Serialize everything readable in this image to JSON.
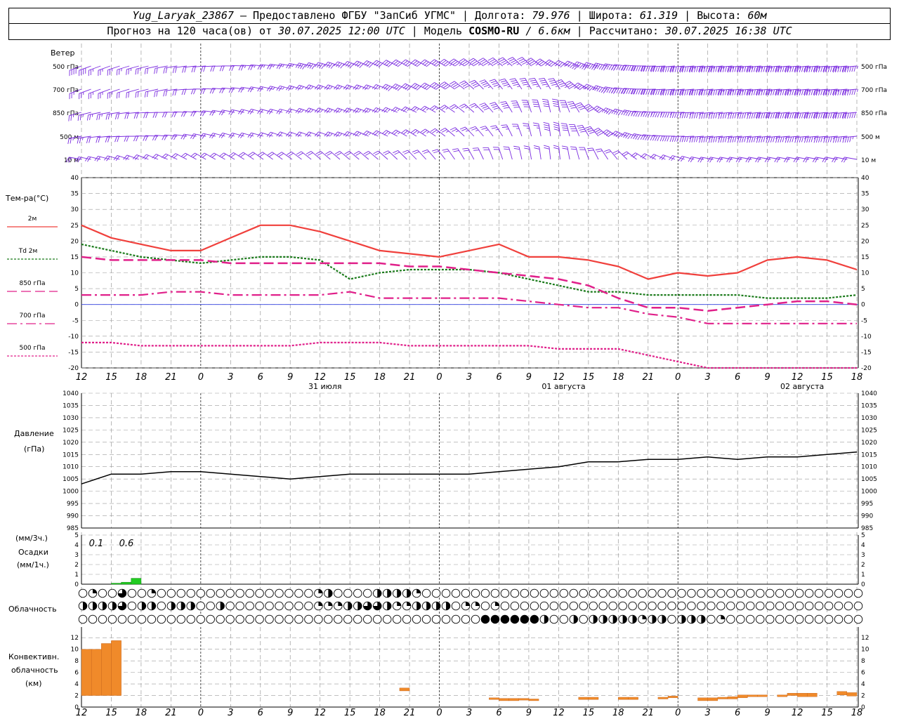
{
  "header": {
    "station": "Yug_Laryak_23867",
    "provided_by": "— Предоставлено ФГБУ \"ЗапСиб УГМС\"",
    "lon_label": "Долгота:",
    "lon_value": "79.976",
    "lat_label": "Широта:",
    "lat_value": "61.319",
    "alt_label": "Высота:",
    "alt_value": "60м",
    "forecast_label": "Прогноз на 120 часа(ов) от",
    "forecast_start": "30.07.2025 12:00 UTC",
    "model_label": "Модель",
    "model_name": "COSMO-RU",
    "model_res": "/ 6.6км",
    "computed_label": "Рассчитано:",
    "computed_time": "30.07.2025 16:38 UTC"
  },
  "panels": {
    "wind": {
      "title": "Ветер",
      "levels": [
        "500 гПа",
        "700 гПа",
        "850 гПа",
        "500 м",
        "10 м"
      ],
      "color": "#7b2ce0"
    },
    "temperature": {
      "title": "Тем-ра(°C)",
      "legend": [
        {
          "label": "2м",
          "color": "#f0403c"
        },
        {
          "label": "Td 2м",
          "color": "#1a7a1a"
        },
        {
          "label": "850 гПа",
          "color": "#e0208a"
        },
        {
          "label": "700 гПа",
          "color": "#e0208a"
        },
        {
          "label": "500 гПа",
          "color": "#e0208a"
        }
      ],
      "yticks": [
        "40",
        "35",
        "30",
        "25",
        "20",
        "15",
        "10",
        "5",
        "0",
        "-5",
        "-10",
        "-15",
        "-20"
      ]
    },
    "pressure": {
      "title": "Давление",
      "unit": "(гПа)",
      "yticks": [
        "1040",
        "1035",
        "1030",
        "1025",
        "1020",
        "1015",
        "1010",
        "1005",
        "1000",
        "995",
        "990",
        "985"
      ]
    },
    "precip": {
      "unit1": "(мм/3ч.)",
      "title": "Осадки",
      "unit2": "(мм/1ч.)",
      "yticks": [
        "5",
        "4",
        "3",
        "2",
        "1",
        "0"
      ],
      "annotations": [
        "0.1",
        "0.6"
      ],
      "color": "#22cc22"
    },
    "cloud": {
      "title": "Облачность"
    },
    "conv": {
      "title1": "Конвективн.",
      "title2": "облачность",
      "unit": "(км)",
      "yticks": [
        "12",
        "10",
        "8",
        "6",
        "4",
        "2",
        "0"
      ],
      "color": "#f08a2a"
    }
  },
  "time_axis": {
    "hour_labels": [
      "12",
      "15",
      "18",
      "21",
      "0",
      "3",
      "6",
      "9",
      "12",
      "15",
      "18",
      "21",
      "0",
      "3",
      "6",
      "9",
      "12",
      "15",
      "18",
      "21",
      "0",
      "3",
      "6",
      "9",
      "12",
      "15",
      "18"
    ],
    "date_labels": [
      "31 июля",
      "01 августа",
      "02 августа"
    ]
  },
  "chart_data": {
    "type": "line",
    "x_hours_from_start": [
      0,
      3,
      6,
      9,
      12,
      15,
      18,
      21,
      24,
      27,
      30,
      33,
      36,
      39,
      42,
      45,
      48,
      51,
      54,
      57,
      60,
      63,
      66,
      69,
      72,
      75,
      78
    ],
    "series": [
      {
        "name": "2м",
        "values": [
          25,
          21,
          19,
          17,
          17,
          21,
          25,
          25,
          23,
          20,
          17,
          16,
          15,
          17,
          19,
          15,
          15,
          14,
          12,
          8,
          10,
          9,
          10,
          14,
          15,
          14,
          11
        ]
      },
      {
        "name": "Td 2м",
        "values": [
          19,
          17,
          15,
          14,
          13,
          14,
          15,
          15,
          14,
          8,
          10,
          11,
          11,
          11,
          10,
          8,
          6,
          4,
          4,
          3,
          3,
          3,
          3,
          2,
          2,
          2,
          3
        ]
      },
      {
        "name": "850 гПа",
        "values": [
          15,
          14,
          14,
          14,
          14,
          13,
          13,
          13,
          13,
          13,
          13,
          12,
          12,
          11,
          10,
          9,
          8,
          6,
          2,
          -1,
          -1,
          -2,
          -1,
          0,
          1,
          1,
          0
        ]
      },
      {
        "name": "700 гПа",
        "values": [
          3,
          3,
          3,
          4,
          4,
          3,
          3,
          3,
          3,
          4,
          2,
          2,
          2,
          2,
          2,
          1,
          0,
          -1,
          -1,
          -3,
          -4,
          -6,
          -6,
          -6,
          -6,
          -6,
          -6
        ]
      },
      {
        "name": "500 гПа",
        "values": [
          -12,
          -12,
          -13,
          -13,
          -13,
          -13,
          -13,
          -13,
          -12,
          -12,
          -12,
          -13,
          -13,
          -13,
          -13,
          -13,
          -14,
          -14,
          -14,
          -16,
          -18,
          -20,
          -21,
          -21,
          -21,
          -21,
          -21
        ]
      },
      {
        "name": "Давление",
        "values": [
          1003,
          1007,
          1007,
          1008,
          1008,
          1007,
          1006,
          1005,
          1006,
          1007,
          1007,
          1007,
          1007,
          1007,
          1008,
          1009,
          1010,
          1012,
          1012,
          1013,
          1013,
          1014,
          1013,
          1014,
          1014,
          1015,
          1016
        ]
      }
    ],
    "precip_3h": [
      {
        "x": 3,
        "value": 0.1
      },
      {
        "x": 6,
        "value": 0.6
      }
    ],
    "precip_1h": [
      {
        "x": 4,
        "value": 0.1
      },
      {
        "x": 5,
        "value": 0.2
      },
      {
        "x": 6,
        "value": 0.6
      }
    ],
    "convective_cloud_km": [
      {
        "x": 1,
        "base": 2,
        "top": 10
      },
      {
        "x": 2,
        "base": 2,
        "top": 10
      },
      {
        "x": 3,
        "base": 2,
        "top": 11
      },
      {
        "x": 4,
        "base": 2,
        "top": 11.5
      },
      {
        "x": 33,
        "base": 2.8,
        "top": 3.3
      },
      {
        "x": 42,
        "base": 1.3,
        "top": 1.6
      },
      {
        "x": 43,
        "base": 1.1,
        "top": 1.5
      },
      {
        "x": 44,
        "base": 1.1,
        "top": 1.5
      },
      {
        "x": 45,
        "base": 1.2,
        "top": 1.5
      },
      {
        "x": 46,
        "base": 1.1,
        "top": 1.4
      },
      {
        "x": 51,
        "base": 1.3,
        "top": 1.7
      },
      {
        "x": 52,
        "base": 1.3,
        "top": 1.7
      },
      {
        "x": 55,
        "base": 1.3,
        "top": 1.7
      },
      {
        "x": 56,
        "base": 1.3,
        "top": 1.7
      },
      {
        "x": 59,
        "base": 1.4,
        "top": 1.7
      },
      {
        "x": 60,
        "base": 1.6,
        "top": 1.9
      },
      {
        "x": 63,
        "base": 1.1,
        "top": 1.6
      },
      {
        "x": 64,
        "base": 1.1,
        "top": 1.6
      },
      {
        "x": 65,
        "base": 1.4,
        "top": 1.7
      },
      {
        "x": 66,
        "base": 1.4,
        "top": 1.8
      },
      {
        "x": 67,
        "base": 1.6,
        "top": 2.1
      },
      {
        "x": 68,
        "base": 1.8,
        "top": 2.1
      },
      {
        "x": 69,
        "base": 1.8,
        "top": 2.1
      },
      {
        "x": 71,
        "base": 1.8,
        "top": 2.1
      },
      {
        "x": 72,
        "base": 2.0,
        "top": 2.4
      },
      {
        "x": 73,
        "base": 1.8,
        "top": 2.4
      },
      {
        "x": 74,
        "base": 1.8,
        "top": 2.4
      },
      {
        "x": 77,
        "base": 2.1,
        "top": 2.7
      },
      {
        "x": 78,
        "base": 1.9,
        "top": 2.5
      }
    ],
    "cloud_cover_rows": {
      "upper": "0100300100000000000000001200002222100000000000000000000000000000000000000000000000000",
      "middle": "222230220222002000000000111223321122220110100000000000000000000000000000000000000000000",
      "lower": "000000000000000000000000000000000000000004444442002022222122022201000000000000000000220"
    }
  }
}
